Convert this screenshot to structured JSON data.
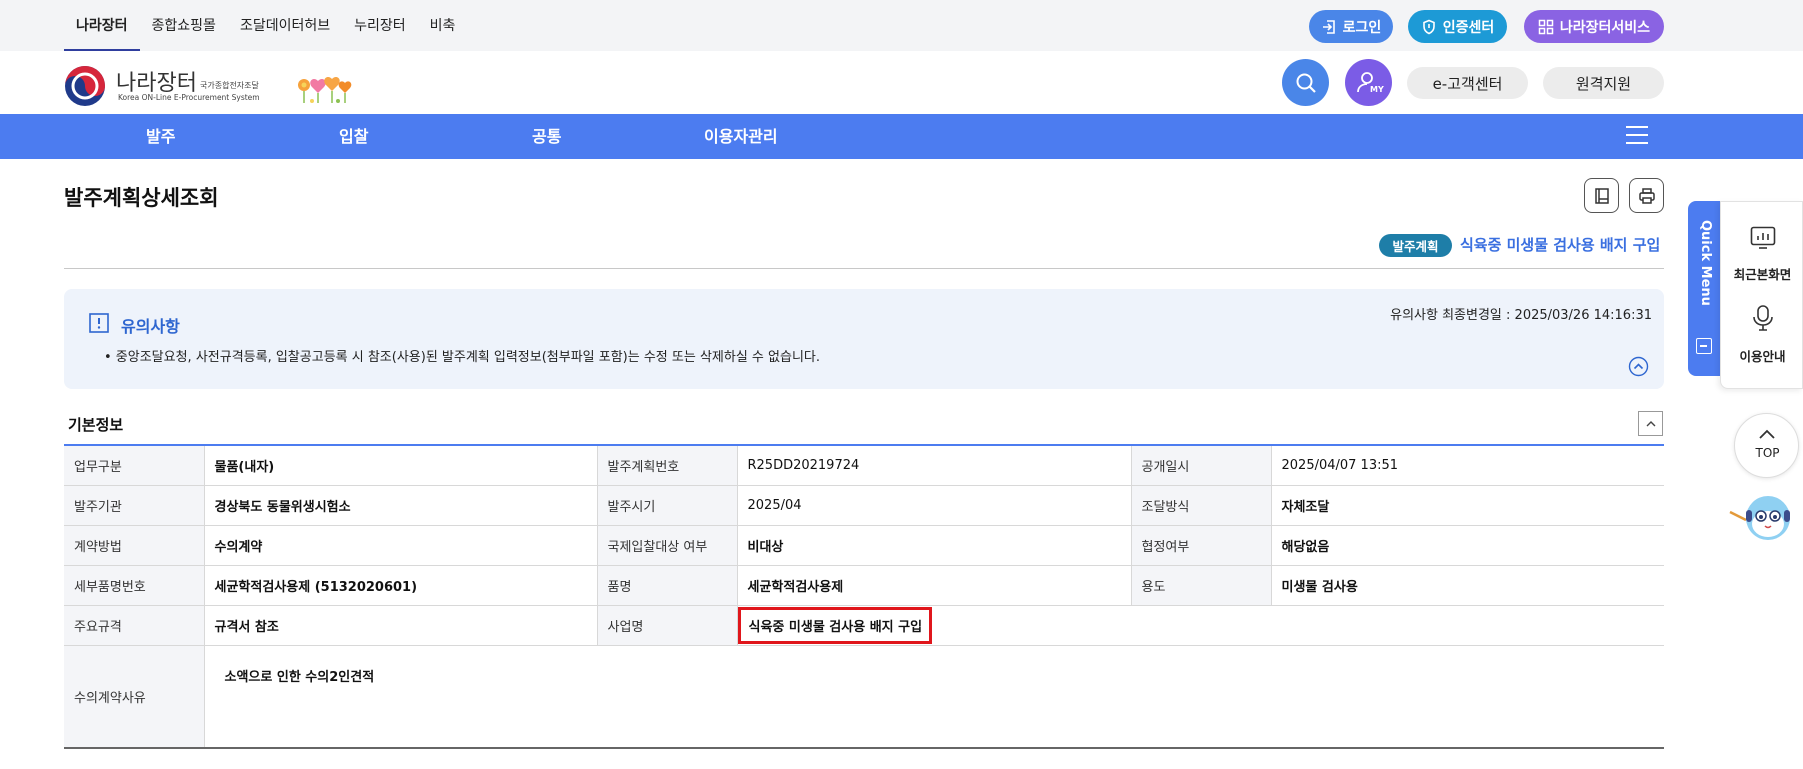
{
  "topnav": {
    "items": [
      "나라장터",
      "종합쇼핑몰",
      "조달데이터허브",
      "누리장터",
      "비축"
    ],
    "login_label": "로그인",
    "cert_label": "인증센터",
    "services_label": "나라장터서비스"
  },
  "header": {
    "logo_name": "나라장터",
    "logo_sub": "국가종합전자조달",
    "logo_en": "Korea ON-Line E-Procurement System",
    "my_label": "MY",
    "customer_center": "e-고객센터",
    "remote_support": "원격지원"
  },
  "mainnav": {
    "items": [
      "발주",
      "입찰",
      "공통",
      "이용자관리"
    ]
  },
  "page": {
    "title": "발주계획상세조회",
    "badge": "발주계획",
    "biz_title": "식육중 미생물 검사용 배지 구입"
  },
  "notice": {
    "title": "유의사항",
    "updated": "유의사항 최종변경일 : 2025/03/26 14:16:31",
    "text": "• 중앙조달요청, 사전규격등록, 입찰공고등록 시 참조(사용)된 발주계획 입력정보(첨부파일 포함)는 수정 또는 삭제하실 수 없습니다."
  },
  "basic_info": {
    "title": "기본정보",
    "rows": [
      [
        [
          "업무구분",
          "물품(내자)"
        ],
        [
          "발주계획번호",
          "R25DD20219724"
        ],
        [
          "공개일시",
          "2025/04/07 13:51"
        ]
      ],
      [
        [
          "발주기관",
          "경상북도 동물위생시험소"
        ],
        [
          "발주시기",
          "2025/04"
        ],
        [
          "조달방식",
          "자체조달"
        ]
      ],
      [
        [
          "계약방법",
          "수의계약"
        ],
        [
          "국제입찰대상 여부",
          "비대상"
        ],
        [
          "협정여부",
          "해당없음"
        ]
      ],
      [
        [
          "세부품명번호",
          "세균학적검사용제 (5132020601)"
        ],
        [
          "품명",
          "세균학적검사용제"
        ],
        [
          "용도",
          "미생물 검사용"
        ]
      ]
    ],
    "spec_label": "주요규격",
    "spec_value": "규격서 참조",
    "biz_name_label": "사업명",
    "biz_name_value": "식육중 미생물 검사용 배지 구입",
    "reason_label": "수의계약사유",
    "reason_value": "소액으로 인한 수의2인견적"
  },
  "quick_menu": {
    "label": "Quick Menu",
    "recent": "최근본화면",
    "guide": "이용안내",
    "top": "TOP"
  },
  "colors": {
    "nav_blue": "#4c7cf0",
    "login_blue": "#4a86e8",
    "cert_cyan": "#1d9ad6",
    "services_purple": "#8a63e3",
    "badge_teal": "#1e7ea8",
    "highlight_red": "#e0161c"
  }
}
